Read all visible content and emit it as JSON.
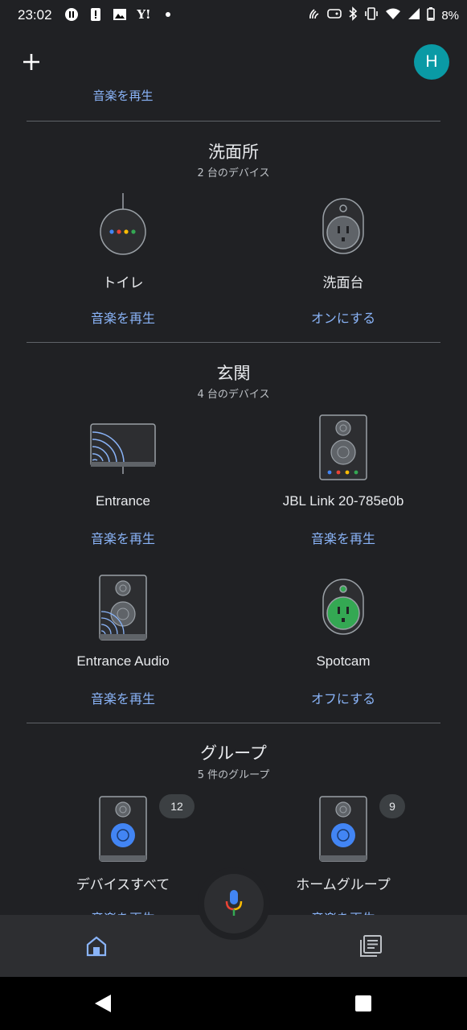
{
  "status_bar": {
    "time": "23:02",
    "battery": "8%",
    "left_icons": [
      "pause-icon",
      "alert-icon",
      "image-icon",
      "yahoo-icon",
      "dot-icon"
    ],
    "right_icons": [
      "nfc-icon",
      "game-icon",
      "bluetooth-icon",
      "vibrate-icon",
      "wifi-icon",
      "signal-icon",
      "battery-icon"
    ]
  },
  "header": {
    "avatar_letter": "H",
    "cut_action": "音楽を再生"
  },
  "rooms": [
    {
      "title": "洗面所",
      "subtitle": "2 台のデバイス",
      "devices": [
        {
          "name": "トイレ",
          "action": "音楽を再生",
          "icon": "smart-speaker-icon"
        },
        {
          "name": "洗面台",
          "action": "オンにする",
          "icon": "smart-plug-icon"
        }
      ]
    },
    {
      "title": "玄関",
      "subtitle": "4 台のデバイス",
      "devices": [
        {
          "name": "Entrance",
          "action": "音楽を再生",
          "icon": "cast-display-icon"
        },
        {
          "name": "JBL Link 20-785e0b",
          "action": "音楽を再生",
          "icon": "speaker-icon"
        },
        {
          "name": "Entrance Audio",
          "action": "音楽を再生",
          "icon": "cast-speaker-icon"
        },
        {
          "name": "Spotcam",
          "action": "オフにする",
          "icon": "smart-plug-on-icon"
        }
      ]
    },
    {
      "title": "グループ",
      "subtitle": "5 件のグループ",
      "devices": [
        {
          "name": "デバイスすべて",
          "action": "音楽を再生",
          "badge": "12",
          "icon": "speaker-group-icon"
        },
        {
          "name": "ホームグループ",
          "action": "音楽を再生",
          "badge": "9",
          "icon": "speaker-group-icon"
        }
      ]
    }
  ],
  "bottom_nav": {
    "items": [
      "home-icon",
      "feed-icon"
    ],
    "fab": "mic-icon"
  },
  "system_nav": [
    "back-icon",
    "overview-icon"
  ],
  "colors": {
    "background": "#202124",
    "accent": "#8ab4f8",
    "avatar": "#0a9aa5",
    "plug_on": "#34a853"
  }
}
